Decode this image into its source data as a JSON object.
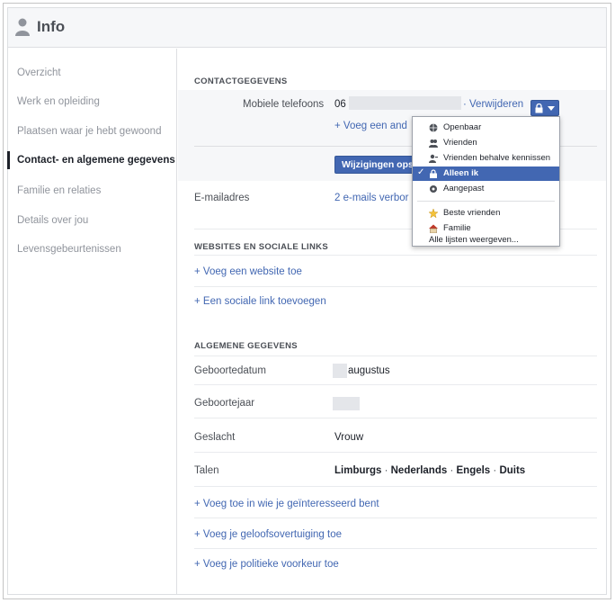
{
  "header": {
    "title": "Info"
  },
  "sidebar": {
    "items": [
      {
        "label": "Overzicht"
      },
      {
        "label": "Werk en opleiding"
      },
      {
        "label": "Plaatsen waar je hebt gewoond"
      },
      {
        "label": "Contact- en algemene gegevens"
      },
      {
        "label": "Familie en relaties"
      },
      {
        "label": "Details over jou"
      },
      {
        "label": "Levensgebeurtenissen"
      }
    ],
    "active_index": 3
  },
  "contact": {
    "heading": "CONTACTGEGEVENS",
    "mobile_label": "Mobiele telefoons",
    "mobile_value_prefix": "06",
    "remove_link": "· Verwijderen",
    "add_link": "+ Voeg een and",
    "save_button": "Wijzigingen opslaan",
    "email_label": "E-mailadres",
    "email_value": "2 e-mails verbor"
  },
  "privacy_menu": {
    "items": [
      {
        "label": "Openbaar",
        "icon": "globe-icon"
      },
      {
        "label": "Vrienden",
        "icon": "friends-icon"
      },
      {
        "label": "Vrienden behalve kennissen",
        "icon": "friends-except-icon"
      },
      {
        "label": "Alleen ik",
        "icon": "lock-icon",
        "checked": "✓"
      },
      {
        "label": "Aangepast",
        "icon": "gear-icon"
      }
    ],
    "lists": [
      {
        "label": "Beste vrienden",
        "icon": "star-icon"
      },
      {
        "label": "Familie",
        "icon": "house-icon"
      }
    ],
    "show_all": "Alle lijsten weergeven..."
  },
  "websites": {
    "heading": "WEBSITES EN SOCIALE LINKS",
    "add_website": "+ Voeg een website toe",
    "add_social": "+ Een sociale link toevoegen"
  },
  "general": {
    "heading": "ALGEMENE GEGEVENS",
    "birthdate_label": "Geboortedatum",
    "birthdate_value": "augustus",
    "birthyear_label": "Geboortejaar",
    "gender_label": "Geslacht",
    "gender_value": "Vrouw",
    "languages_label": "Talen",
    "languages": [
      "Limburgs",
      "Nederlands",
      "Engels",
      "Duits"
    ],
    "add_interested": "+ Voeg toe in wie je geïnteresseerd bent",
    "add_religion": "+ Voeg je geloofsovertuiging toe",
    "add_politics": "+ Voeg je politieke voorkeur toe"
  },
  "colors": {
    "accent": "#4267b2",
    "muted_text": "#90949c",
    "panel": "#f6f7f9"
  }
}
